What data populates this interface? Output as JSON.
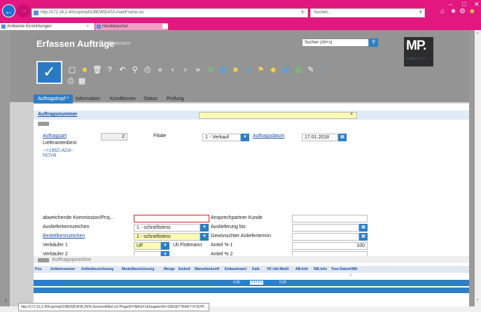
{
  "browser": {
    "url": "http://172.16.2.40/csp/mp01/BEWIDATA.mainFrame.cls",
    "search_placeholder": "Suchen...",
    "tabs": [
      {
        "label": "Ambiente Einrichtungen"
      },
      {
        "label": "Händlerportal"
      }
    ],
    "status_url": "http://172.16.2.40/csp/mp01/BEWIDATA.ZEN.GenericAtNet.cls?PageID=INAUF1&SupplierNr=1862&YTRAKT=37&YP..."
  },
  "app": {
    "title": "Erfassen Aufträge",
    "user": "Uli Flottmann",
    "search_placeholder": "Suchen (Alt+s)",
    "logo_text": "MP.",
    "logo_sub": "MÖBELPILOT"
  },
  "tabs": [
    "Auftragskopf *",
    "Information",
    "Konditionen",
    "Status",
    "Prüfung"
  ],
  "form": {
    "auftragsnummer_label": "Auftragsnummer",
    "auftragsart_label": "Auftragsart",
    "auftragsart_value": "2",
    "lieferantenbest_label": "Lieferantenbest",
    "lieferantenbest_link": "-->1862,ADA-NOVA",
    "filiale_label": "Filiale",
    "filiale_value": "1 - Verkauf",
    "auftragsdatum_label": "Auftragsdatum",
    "auftragsdatum_value": "17.01.2018",
    "kommission_label": "abweichende Kommission/Proj...",
    "kommission_value": "",
    "auslieferkennzeichen_label": "Auslieferkennzeichen",
    "auslieferkennzeichen_value": "1 - schnellstens",
    "bestellkennzeichen_label": "Bestellkennzeichen",
    "bestellkennzeichen_value": "1 - schnellstens",
    "verkaeufer1_label": "Verkäufer 1",
    "verkaeufer1_value": "UF",
    "verkaeufer1_name": "Uli Flottmann",
    "verkaeufer2_label": "Verkäufer 2",
    "ansprechpartner_label": "Ansprechpartner Kunde",
    "auslieferung_label": "Auslieferung bis",
    "anliefertermin_label": "Gewünschter Anliefertermin",
    "anteil1_label": "Anteil % 1",
    "anteil1_value": "100",
    "anteil2_label": "Anteil % 2"
  },
  "positions": {
    "section_label": "Auftragsposition",
    "columns": [
      "Pos.",
      "Artikelnummer",
      "Artikelbezeichnung",
      "Modellbezeichnung",
      "Menge",
      "Einheit",
      "Warenherkunft",
      "Einkaufswert",
      "Kalk.",
      "VK inkl.MwSt",
      "AB-Info",
      "WE-Info",
      "Tour-Datum/WA"
    ],
    "total_ek": "0,00",
    "total_kalk": "XXXXX",
    "total_vk": "0,00",
    "tour_value": "- /"
  }
}
